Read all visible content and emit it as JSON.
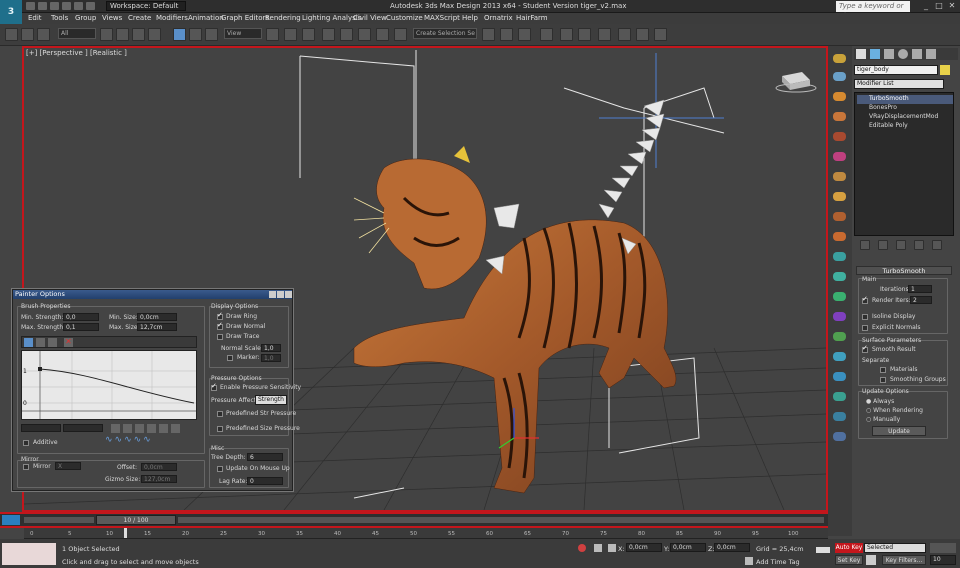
{
  "app": {
    "title": "Autodesk 3ds Max Design 2013 x64 - Student Version  tiger_v2.max",
    "logo": "3ds-max-logo-icon"
  },
  "quick_access": {
    "workspace_label": "Workspace: Default",
    "search_placeholder": "Type a keyword or phrase"
  },
  "menu": [
    "Edit",
    "Tools",
    "Group",
    "Views",
    "Create",
    "Modifiers",
    "Animation",
    "Graph Editors",
    "Rendering",
    "Lighting Analysis",
    "Civil View",
    "Customize",
    "MAXScript",
    "Help",
    "Ornatrix",
    "HairFarm"
  ],
  "toolbar": {
    "filter_value": "All",
    "view_value": "View",
    "selection_set_placeholder": "Create Selection Se"
  },
  "viewport": {
    "label": "[+] [Perspective ] [Realistic ]"
  },
  "command_panel": {
    "object_name": "tiger_body",
    "object_color": "#e8d24a",
    "modifier_list_label": "Modifier List",
    "stack": [
      "TurboSmooth",
      "BonesPro",
      "VRayDisplacementMod",
      "Editable Poly"
    ],
    "turbosmooth": {
      "title": "TurboSmooth",
      "main_label": "Main",
      "iterations_label": "Iterations:",
      "iterations_value": "1",
      "render_iters_label": "Render Iters:",
      "render_iters_value": "2",
      "isoline_label": "Isoline Display",
      "explicit_normals_label": "Explicit Normals",
      "surface_label": "Surface Parameters",
      "smooth_result_label": "Smooth Result",
      "separate_label": "Separate",
      "materials_label": "Materials",
      "smoothing_groups_label": "Smoothing Groups",
      "update_options_label": "Update Options",
      "always_label": "Always",
      "when_rendering_label": "When Rendering",
      "manually_label": "Manually",
      "update_button": "Update"
    }
  },
  "painter": {
    "title": "Painter Options",
    "brush_props": "Brush Properties",
    "min_strength_label": "Min. Strength:",
    "min_strength_value": "0,0",
    "max_strength_label": "Max. Strength:",
    "max_strength_value": "0,1",
    "min_size_label": "Min. Size:",
    "min_size_value": "0,0cm",
    "max_size_label": "Max. Size:",
    "max_size_value": "12,7cm",
    "curve_y1": "1",
    "curve_y0": "0",
    "additive_label": "Additive",
    "mirror_label": "Mirror",
    "mirror_check_label": "Mirror",
    "mirror_axis": "X",
    "offset_label": "Offset:",
    "offset_value": "0,0cm",
    "gizmo_label": "Gizmo Size:",
    "gizmo_value": "127,0cm",
    "display_label": "Display Options",
    "draw_ring": "Draw Ring",
    "draw_normal": "Draw Normal",
    "draw_trace": "Draw Trace",
    "normal_scale_label": "Normal Scale:",
    "normal_scale_value": "1,0",
    "marker_label": "Marker:",
    "marker_value": "1,0",
    "pressure_label": "Pressure Options",
    "enable_pressure": "Enable Pressure Sensitivity",
    "pressure_affects_label": "Pressure Affects:",
    "pressure_affects_value": "Strength",
    "predefined_str": "Predefined Str Pressure",
    "predefined_size": "Predefined Size Pressure",
    "misc_label": "Misc",
    "tree_depth_label": "Tree Depth:",
    "tree_depth_value": "6",
    "update_mouse": "Update On Mouse Up",
    "lag_rate_label": "Lag Rate:",
    "lag_rate_value": "0"
  },
  "timeline": {
    "slider": "10 / 100",
    "ticks": [
      "0",
      "5",
      "10",
      "15",
      "20",
      "25",
      "30",
      "35",
      "40",
      "45",
      "50",
      "55",
      "60",
      "65",
      "70",
      "75",
      "80",
      "85",
      "90",
      "95",
      "100"
    ]
  },
  "status": {
    "selected": "1 Object Selected",
    "prompt": "Click and drag to select and move objects",
    "x_label": "X:",
    "x_value": "0,0cm",
    "y_label": "Y:",
    "y_value": "0,0cm",
    "z_label": "Z:",
    "z_value": "0,0cm",
    "grid": "Grid = 25,4cm",
    "add_time_tag": "Add Time Tag",
    "auto_key": "Auto Key",
    "set_key": "Set Key",
    "selected_dd": "Selected",
    "key_filters": "Key Filters...",
    "frame": "10"
  }
}
